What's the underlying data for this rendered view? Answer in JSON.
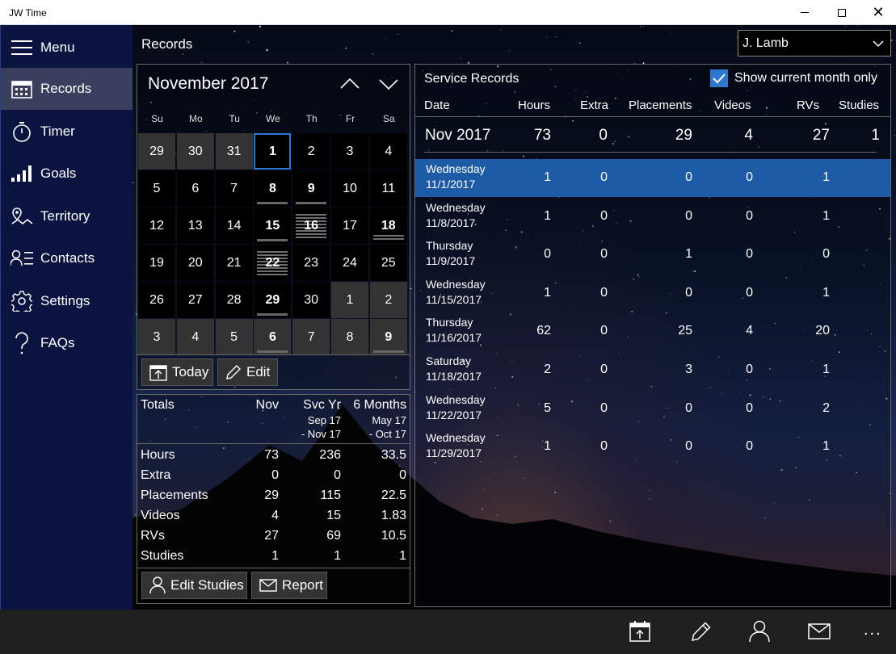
{
  "window": {
    "title": "JW Time"
  },
  "nav": {
    "items": [
      {
        "label": "Menu",
        "icon": "hamburger-icon"
      },
      {
        "label": "Records",
        "icon": "calendar-icon"
      },
      {
        "label": "Timer",
        "icon": "stopwatch-icon"
      },
      {
        "label": "Goals",
        "icon": "signal-bars-icon"
      },
      {
        "label": "Territory",
        "icon": "map-icon"
      },
      {
        "label": "Contacts",
        "icon": "contacts-icon"
      },
      {
        "label": "Settings",
        "icon": "gear-icon"
      },
      {
        "label": "FAQs",
        "icon": "question-icon"
      }
    ]
  },
  "page": {
    "title": "Records"
  },
  "user": {
    "selected": "J. Lamb"
  },
  "calendar": {
    "month_label": "November 2017",
    "days_of_week": [
      "Su",
      "Mo",
      "Tu",
      "We",
      "Th",
      "Fr",
      "Sa"
    ],
    "weeks": [
      [
        "29",
        "30",
        "31",
        "1",
        "2",
        "3",
        "4"
      ],
      [
        "5",
        "6",
        "7",
        "8",
        "9",
        "10",
        "11"
      ],
      [
        "12",
        "13",
        "14",
        "15",
        "16",
        "17",
        "18"
      ],
      [
        "19",
        "20",
        "21",
        "22",
        "23",
        "24",
        "25"
      ],
      [
        "26",
        "27",
        "28",
        "29",
        "30",
        "1",
        "2"
      ],
      [
        "3",
        "4",
        "5",
        "6",
        "7",
        "8",
        "9"
      ]
    ],
    "today_label": "Today",
    "edit_label": "Edit"
  },
  "totals": {
    "header": "Totals",
    "col1": "Nov",
    "col2": "Svc Yr",
    "col2_sub1": "Sep 17",
    "col2_sub2": "- Nov 17",
    "col3": "6 Months",
    "col3_sub1": "May 17",
    "col3_sub2": "- Oct 17",
    "rows": [
      {
        "label": "Hours",
        "v1": "73",
        "v2": "236",
        "v3": "33.5"
      },
      {
        "label": "Extra",
        "v1": "0",
        "v2": "0",
        "v3": "0"
      },
      {
        "label": "Placements",
        "v1": "29",
        "v2": "115",
        "v3": "22.5"
      },
      {
        "label": "Videos",
        "v1": "4",
        "v2": "15",
        "v3": "1.83"
      },
      {
        "label": "RVs",
        "v1": "27",
        "v2": "69",
        "v3": "10.5"
      },
      {
        "label": "Studies",
        "v1": "1",
        "v2": "1",
        "v3": "1"
      }
    ],
    "edit_studies_label": "Edit Studies",
    "report_label": "Report"
  },
  "service": {
    "title": "Service Records",
    "show_current_label": "Show current month only",
    "columns": {
      "date": "Date",
      "hours": "Hours",
      "extra": "Extra",
      "placements": "Placements",
      "videos": "Videos",
      "rvs": "RVs",
      "studies": "Studies"
    },
    "month_summary": {
      "date": "Nov 2017",
      "hours": "73",
      "extra": "0",
      "placements": "29",
      "videos": "4",
      "rvs": "27",
      "studies": "1"
    },
    "records": [
      {
        "day": "Wednesday",
        "date": "11/1/2017",
        "hours": "1",
        "extra": "0",
        "placements": "0",
        "videos": "0",
        "rvs": "1"
      },
      {
        "day": "Wednesday",
        "date": "11/8/2017",
        "hours": "1",
        "extra": "0",
        "placements": "0",
        "videos": "0",
        "rvs": "1"
      },
      {
        "day": "Thursday",
        "date": "11/9/2017",
        "hours": "0",
        "extra": "0",
        "placements": "1",
        "videos": "0",
        "rvs": "0"
      },
      {
        "day": "Wednesday",
        "date": "11/15/2017",
        "hours": "1",
        "extra": "0",
        "placements": "0",
        "videos": "0",
        "rvs": "1"
      },
      {
        "day": "Thursday",
        "date": "11/16/2017",
        "hours": "62",
        "extra": "0",
        "placements": "25",
        "videos": "4",
        "rvs": "20"
      },
      {
        "day": "Saturday",
        "date": "11/18/2017",
        "hours": "2",
        "extra": "0",
        "placements": "3",
        "videos": "0",
        "rvs": "1"
      },
      {
        "day": "Wednesday",
        "date": "11/22/2017",
        "hours": "5",
        "extra": "0",
        "placements": "0",
        "videos": "0",
        "rvs": "2"
      },
      {
        "day": "Wednesday",
        "date": "11/29/2017",
        "hours": "1",
        "extra": "0",
        "placements": "0",
        "videos": "0",
        "rvs": "1"
      }
    ]
  },
  "commandbar": {
    "more": "..."
  },
  "colors": {
    "accent": "#2d77d1",
    "nav_bg": "#0b1440",
    "selected_row": "#1e5ba7"
  }
}
